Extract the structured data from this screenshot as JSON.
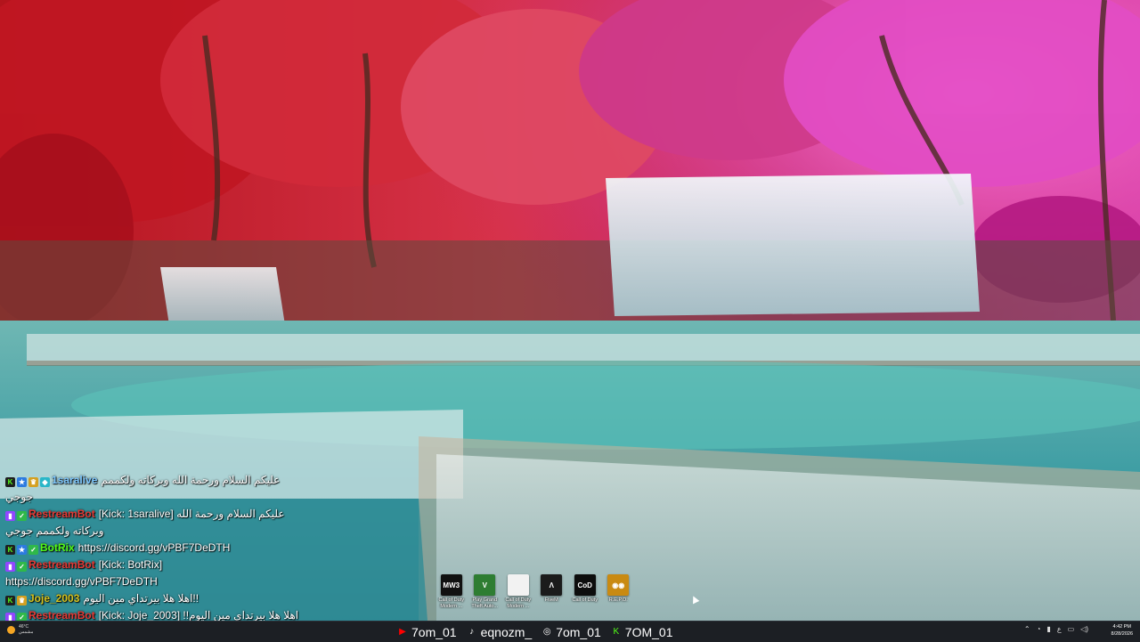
{
  "chat": [
    {
      "badges": [
        "kick",
        "blue",
        "gold",
        "cyan"
      ],
      "user": "1saralive",
      "user_class": "u1",
      "text": "عليكم السلام ورحمة الله وبركاته ولكممم جوجي"
    },
    {
      "badges": [
        "twitch",
        "check"
      ],
      "user": "RestreamBot",
      "user_class": "u-rb",
      "text": "[Kick: 1saralive] عليكم السلام ورحمة الله وبركاته ولكممم جوجي"
    },
    {
      "badges": [
        "kick",
        "blue",
        "check"
      ],
      "user": "BotRix",
      "user_class": "u-bot",
      "text": "https://discord.gg/vPBF7DeDTH"
    },
    {
      "badges": [
        "twitch",
        "check"
      ],
      "user": "RestreamBot",
      "user_class": "u-rb",
      "text": "[Kick: BotRix] https://discord.gg/vPBF7DeDTH"
    },
    {
      "badges": [
        "kick",
        "gold"
      ],
      "user": "Joje_2003",
      "user_class": "u-joje",
      "text": "!!اهلا هلا بيرتداي مين اليوم"
    },
    {
      "badges": [
        "twitch",
        "check"
      ],
      "user": "RestreamBot",
      "user_class": "u-rb",
      "text": "[Kick: Joje_2003] !!اهلا هلا بيرتداي مين اليوم"
    }
  ],
  "desktop_icons": [
    {
      "label": "Call of Duty Modern ...",
      "tile": "MW3",
      "color": "#111111"
    },
    {
      "label": "Play Grand Theft Auto...",
      "tile": "V",
      "color": "#2e7d32"
    },
    {
      "label": "Call of Duty Modern ...",
      "tile": "",
      "color": "#f2f2f2"
    },
    {
      "label": "FiveM",
      "tile": "Λ",
      "color": "#1b1b1b"
    },
    {
      "label": "Call of Duty",
      "tile": "CoD",
      "color": "#0d0d0d"
    },
    {
      "label": "R.E.P.O.",
      "tile": "◉◉",
      "color": "#c98a12"
    }
  ],
  "taskbar": {
    "weather": {
      "temp": "46°C",
      "condition": "مشمس"
    },
    "apps": [
      {
        "icon": "youtube-icon",
        "label": "7om_01",
        "color": "#ff0000"
      },
      {
        "icon": "tiktok-icon",
        "label": "eqnozm_",
        "color": "#ffffff"
      },
      {
        "icon": "instagram-icon",
        "label": "7om_01",
        "color": "#ffffff"
      },
      {
        "icon": "kick-icon",
        "label": "7OM_01",
        "color": "#53fc18"
      }
    ],
    "time": "4:42 PM",
    "date": "8/28/2026",
    "lang": "ع"
  },
  "colors": {
    "taskbar": "#1c1f24",
    "kick_green": "#53fc18",
    "restream_red": "#e53935"
  }
}
